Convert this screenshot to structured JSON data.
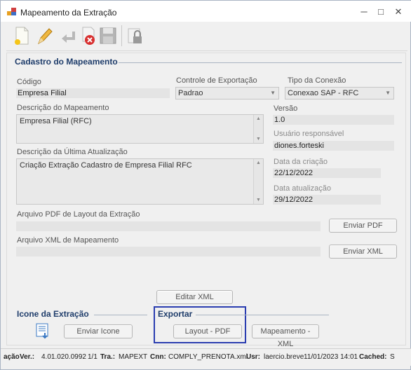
{
  "window": {
    "title": "Mapeamento da Extração",
    "minimize": "─",
    "maximize": "□",
    "close": "✕"
  },
  "toolbar": {
    "buttons": [
      {
        "name": "new-icon"
      },
      {
        "name": "edit-icon"
      },
      {
        "name": "undo-icon"
      },
      {
        "name": "delete-icon"
      },
      {
        "name": "save-icon"
      },
      {
        "name": "lock-icon"
      }
    ]
  },
  "cadastro": {
    "section_title": "Cadastro do Mapeamento",
    "codigo_label": "Código",
    "codigo_value": "Empresa Filial",
    "controle_label": "Controle de Exportação",
    "controle_value": "Padrao",
    "tipo_label": "Tipo da Conexão",
    "tipo_value": "Conexao SAP - RFC",
    "descricao_label": "Descrição do Mapeamento",
    "descricao_value": "Empresa Filial (RFC)",
    "versao_label": "Versão",
    "versao_value": "1.0",
    "usuario_label": "Usuário responsável",
    "usuario_value": "diones.forteski",
    "ultima_label": "Descrição da Última Atualização",
    "ultima_value": "Criação Extração Cadastro de Empresa Filial RFC",
    "data_criacao_label": "Data da criação",
    "data_criacao_value": "22/12/2022",
    "data_atual_label": "Data atualização",
    "data_atual_value": "29/12/2022",
    "pdf_label": "Arquivo PDF de Layout da Extração",
    "pdf_value": "",
    "enviar_pdf": "Enviar PDF",
    "xml_label": "Arquivo XML de Mapeamento",
    "xml_value": "",
    "enviar_xml": "Enviar XML",
    "editar_xml": "Editar XML"
  },
  "icone": {
    "section_title": "Icone da Extração",
    "enviar_icone": "Enviar Icone"
  },
  "exportar": {
    "section_title": "Exportar",
    "layout_pdf": "Layout - PDF",
    "mapeamento_xml": "Mapeamento - XML"
  },
  "status": {
    "prefix": "ação",
    "ver_label": "Ver.:",
    "ver_value": "4.01.020.0992",
    "page": "1/1",
    "tra_label": "Tra.:",
    "tra_value": "MAPEXT",
    "cnn_label": "Cnn:",
    "cnn_value": "COMPLY_PRENOTA.xml",
    "usr_label": "Usr:",
    "usr_value": "laercio.breve",
    "datetime": "11/01/2023  14:01",
    "cached_label": "Cached:",
    "cached_value": "S"
  },
  "colors": {
    "highlight": "#2a3db0",
    "section_title": "#1f3d6b"
  }
}
